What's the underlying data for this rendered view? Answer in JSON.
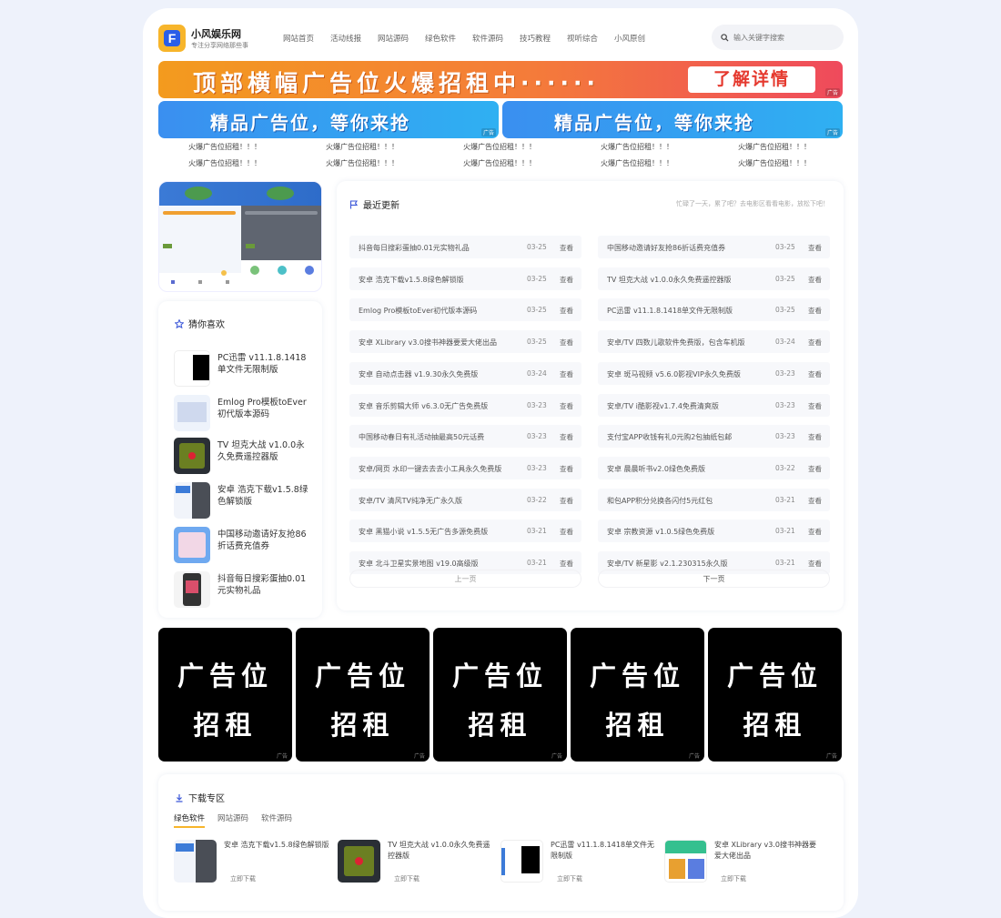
{
  "site": {
    "name": "小风娱乐网",
    "slogan": "专注分享网络那些事",
    "logo_letter": "F",
    "accent": "#f7b52b",
    "brand_blue": "#2a5ee8"
  },
  "nav": [
    "网站首页",
    "活动线报",
    "网站源码",
    "绿色软件",
    "软件源码",
    "技巧教程",
    "视听综合",
    "小风原创"
  ],
  "search": {
    "placeholder": "输入关键字搜索"
  },
  "banners": {
    "top_text": "顶部横幅广告位火爆招租中······",
    "top_button": "了解详情",
    "half_text": "精品广告位，等你来抢",
    "ad_tag": "广告"
  },
  "text_links": [
    "火爆广告位招租！！！",
    "火爆广告位招租！！！",
    "火爆广告位招租！！！",
    "火爆广告位招租！！！",
    "火爆广告位招租！！！",
    "火爆广告位招租！！！",
    "火爆广告位招租！！！",
    "火爆广告位招租！！！",
    "火爆广告位招租！！！",
    "火爆广告位招租！！！"
  ],
  "favorites": {
    "title": "猜你喜欢",
    "items": [
      {
        "title": "PC迅雷 v11.1.8.1418单文件无限制版"
      },
      {
        "title": "Emlog Pro模板toEver初代版本源码"
      },
      {
        "title": "TV 坦克大战 v1.0.0永久免费遥控器版"
      },
      {
        "title": "安卓 浩克下载v1.5.8绿色解锁版"
      },
      {
        "title": "中国移动邀请好友抢86折话费充值券"
      },
      {
        "title": "抖音每日搜彩蛋抽0.01元实物礼品"
      }
    ]
  },
  "updates": {
    "title": "最近更新",
    "subtitle": "忙碌了一天，累了吧？去电影区看看电影，放松下吧！",
    "view_label": "查看",
    "left": [
      {
        "title": "抖音每日搜彩蛋抽0.01元实物礼品",
        "date": "03-25"
      },
      {
        "title": "安卓 浩克下载v1.5.8绿色解锁版",
        "date": "03-25"
      },
      {
        "title": "Emlog Pro模板toEver初代版本源码",
        "date": "03-25"
      },
      {
        "title": "安卓 XLibrary v3.0搜书神器要爱大佬出品",
        "date": "03-25"
      },
      {
        "title": "安卓 自动点击器 v1.9.30永久免费版",
        "date": "03-24"
      },
      {
        "title": "安卓 音乐剪辑大师 v6.3.0无广告免费版",
        "date": "03-23"
      },
      {
        "title": "中国移动春日有礼活动抽最高50元话费",
        "date": "03-23"
      },
      {
        "title": "安卓/网页 水印一键去去去小工具永久免费版",
        "date": "03-23"
      },
      {
        "title": "安卓/TV 清风TV纯净无广永久版",
        "date": "03-22"
      },
      {
        "title": "安卓 黑猫小说 v1.5.5无广告多源免费版",
        "date": "03-21"
      },
      {
        "title": "安卓 北斗卫星实景地图 v19.0高级版",
        "date": "03-21"
      }
    ],
    "right": [
      {
        "title": "中国移动邀请好友抢86折话费充值券",
        "date": "03-25"
      },
      {
        "title": "TV 坦克大战 v1.0.0永久免费遥控器版",
        "date": "03-25"
      },
      {
        "title": "PC迅雷 v11.1.8.1418单文件无限制版",
        "date": "03-25"
      },
      {
        "title": "安卓/TV 四数儿歌软件免费版，包含车机版",
        "date": "03-24"
      },
      {
        "title": "安卓 斑马视频 v5.6.0影视VIP永久免费版",
        "date": "03-23"
      },
      {
        "title": "安卓/TV i酷影视v1.7.4免费清爽版",
        "date": "03-23"
      },
      {
        "title": "支付宝APP收钱有礼0元购2包抽纸包邮",
        "date": "03-23"
      },
      {
        "title": "安卓 晨晨听书v2.0绿色免费版",
        "date": "03-22"
      },
      {
        "title": "和包APP积分兑换各闪付5元红包",
        "date": "03-21"
      },
      {
        "title": "安卓 宗教资源 v1.0.5绿色免费版",
        "date": "03-21"
      },
      {
        "title": "安卓/TV 新星影 v2.1.230315永久版",
        "date": "03-21"
      }
    ],
    "prev": "上一页",
    "next": "下一页"
  },
  "square_ads": {
    "line1": "广告位",
    "line2": "招租",
    "count": 5
  },
  "downloads": {
    "title": "下载专区",
    "tabs": [
      "绿色软件",
      "网站源码",
      "软件源码"
    ],
    "button": "立即下载",
    "items": [
      {
        "title": "安卓 浩克下载v1.5.8绿色解锁版"
      },
      {
        "title": "TV 坦克大战 v1.0.0永久免费遥控器版"
      },
      {
        "title": "PC迅雷 v11.1.8.1418单文件无限制版"
      },
      {
        "title": "安卓 XLibrary v3.0搜书神器要爱大佬出品"
      }
    ]
  }
}
